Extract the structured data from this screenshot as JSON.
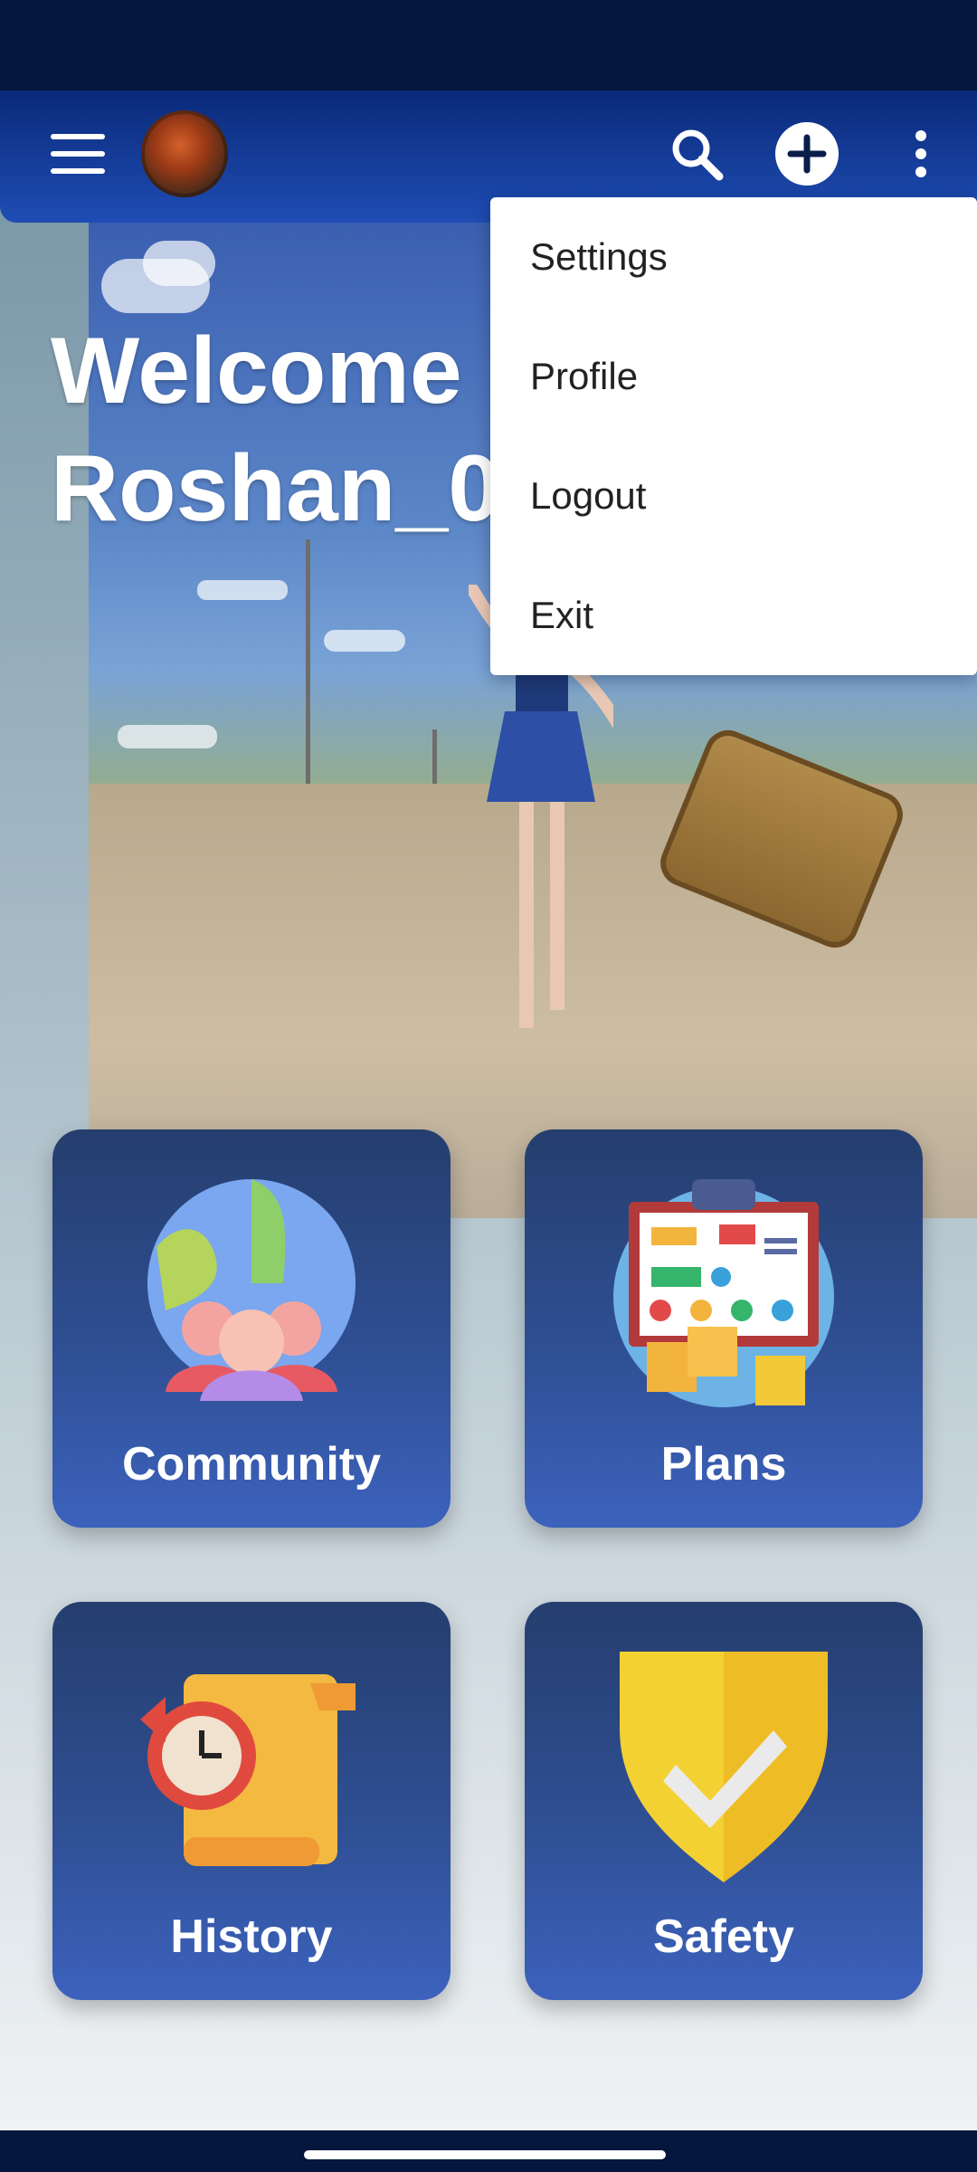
{
  "app": {
    "welcome_line1": "Welcome",
    "welcome_line2": "Roshan_0"
  },
  "toolbar": {
    "menu_icon": "hamburger-icon",
    "search_icon": "search-icon",
    "add_icon": "add-circle-icon",
    "more_icon": "more-vertical-icon"
  },
  "menu": {
    "items": [
      "Settings",
      "Profile",
      "Logout",
      "Exit"
    ]
  },
  "tiles": [
    {
      "label": "Community",
      "icon": "globe-people-icon"
    },
    {
      "label": "Plans",
      "icon": "planning-board-icon"
    },
    {
      "label": "History",
      "icon": "history-scroll-clock-icon"
    },
    {
      "label": "Safety",
      "icon": "shield-check-icon"
    }
  ],
  "colors": {
    "appbar": "#1f4db4",
    "tile": "#2f4f93",
    "status": "#06173d"
  }
}
